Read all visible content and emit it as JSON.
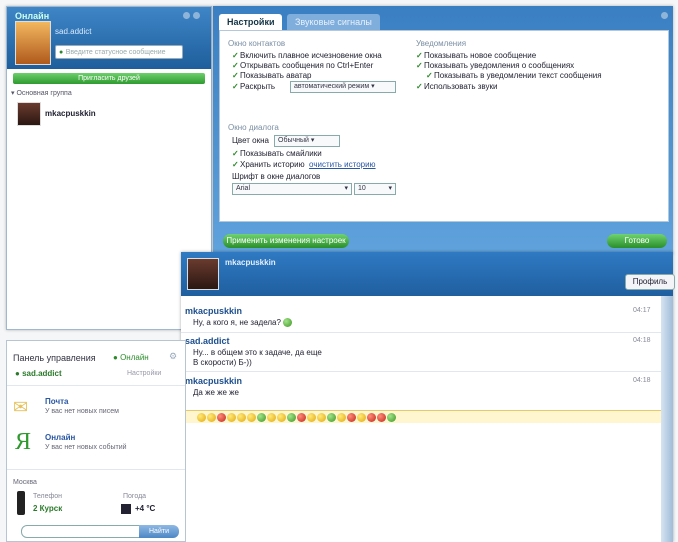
{
  "contact_window": {
    "title": "Онлайн",
    "user_name": "sad.addict",
    "status_placeholder": "Введите статусное сообщение",
    "green_bar_label": "Пригласить друзей",
    "group_label": "Основная группа",
    "contact_name": "mkacpuskkin"
  },
  "settings_window": {
    "tabs": [
      "Настройки",
      "Звуковые сигналы"
    ],
    "left_section": "Окно контактов",
    "left_options": [
      "Включить плавное исчезновение окна",
      "Открывать сообщения по Ctrl+Enter",
      "Показывать аватар",
      "Раскрыть"
    ],
    "raskryt_select": "автоматический режим",
    "right_section": "Уведомления",
    "right_options": [
      "Показывать новое сообщение",
      "Показывать уведомления о сообщениях",
      "Показывать в уведомлении текст сообщения",
      "Использовать звуки"
    ],
    "dialog_section": "Окно диалога",
    "color_label": "Цвет окна",
    "color_value": "Обычный",
    "dialog_options": [
      "Показывать смайлики",
      "Хранить историю"
    ],
    "history_link": "очистить историю",
    "font_label": "Шрифт в окне диалогов",
    "font_name": "Arial",
    "font_size": "10",
    "left_button": "Применить изменения настроек",
    "ok_button": "Готово"
  },
  "chat_window": {
    "title": "mkacpuskkin",
    "send_button": "Профиль",
    "messages": [
      {
        "name": "mkacpuskkin",
        "text": "Ну, а кого я, не задела?",
        "time": "04:17"
      },
      {
        "name": "sad.addict",
        "text": "Ну... в общем это к задаче, да еще",
        "text2": "В скорости) Б-))",
        "time": "04:18"
      },
      {
        "name": "mkacpuskkin",
        "text": "Да же же же",
        "time": "04:18"
      }
    ]
  },
  "control_panel": {
    "title": "Панель управления",
    "status": "Онлайн",
    "user_name": "sad.addict",
    "settings_link": "Настройки",
    "services": [
      {
        "name": "Почта",
        "desc": "У вас нет новых писем"
      },
      {
        "name": "Онлайн",
        "desc": "У вас нет новых событий"
      }
    ],
    "weather_label": "Москва",
    "phone_label": "Телефон",
    "phone_value": "2 Курск",
    "temp_label": "Погода",
    "temp_value": "+4 °C",
    "search_button": "Найти"
  }
}
